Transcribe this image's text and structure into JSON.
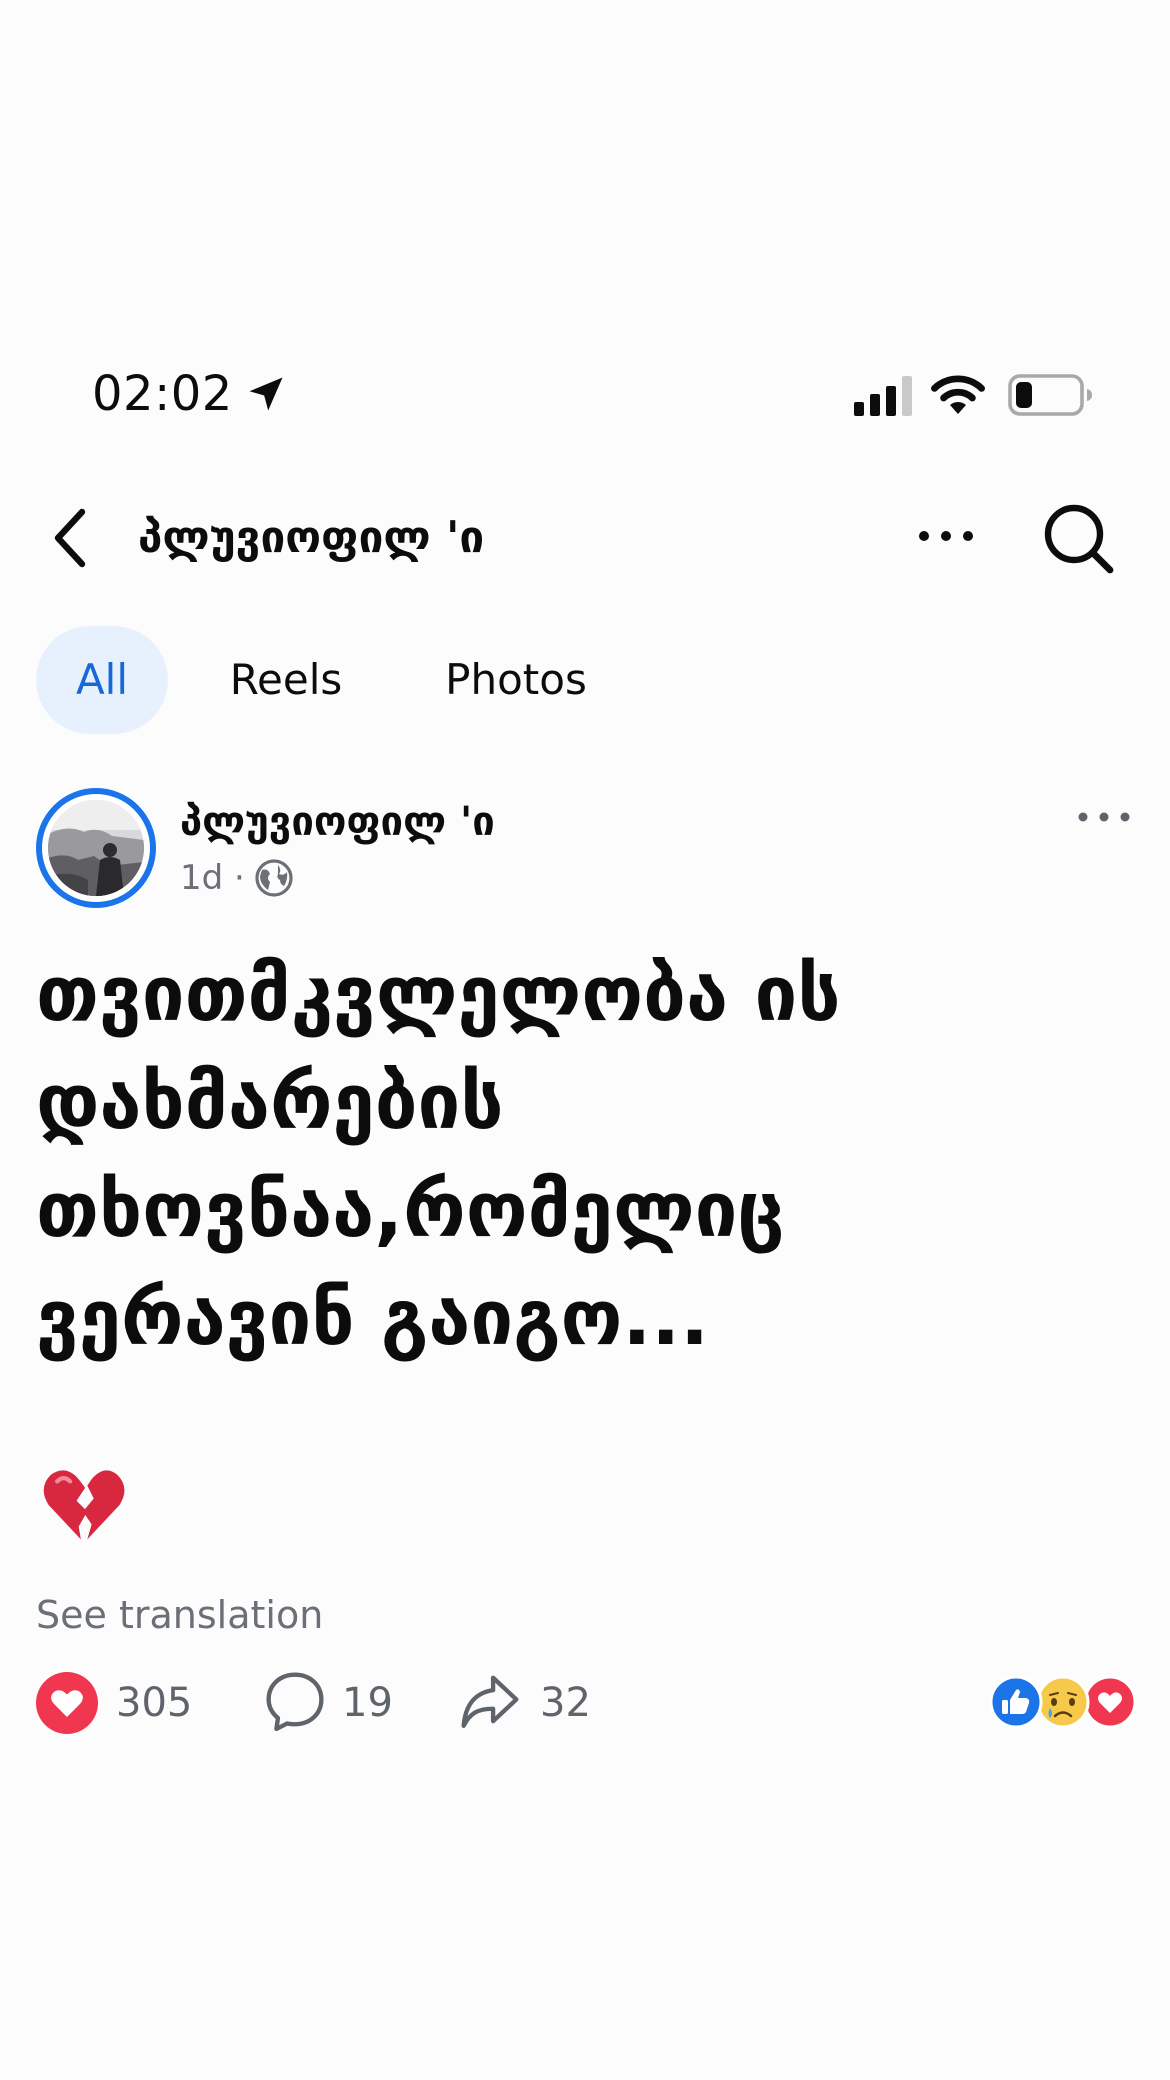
{
  "status_bar": {
    "time": "02:02",
    "icons": [
      "location-arrow-icon",
      "signal-icon",
      "wifi-icon",
      "battery-icon"
    ]
  },
  "header": {
    "title": "პლუვიოფილ 'ი",
    "icons": [
      "back-icon",
      "more-icon",
      "search-icon"
    ]
  },
  "tabs": [
    {
      "label": "All",
      "active": true
    },
    {
      "label": "Reels",
      "active": false
    },
    {
      "label": "Photos",
      "active": false
    }
  ],
  "post": {
    "author": "პლუვიოფილ 'ი",
    "time": "1d ·",
    "audience_icon": "globe-icon",
    "text": "თვითმკვლელობა ის\nდახმარების\nთხოვნაა,რომელიც\nვერავინ გაიგო...",
    "emoji": "broken-heart-icon",
    "see_translation": "See translation",
    "stats": {
      "reactions": "305",
      "comments": "19",
      "shares": "32"
    },
    "reaction_types": [
      "like-icon",
      "sad-icon",
      "love-icon"
    ]
  },
  "colors": {
    "accent_blue": "#1b74e8",
    "active_tab_bg": "#e7f1fd",
    "love_red": "#f0374f",
    "secondary_text": "#6b6f76"
  }
}
